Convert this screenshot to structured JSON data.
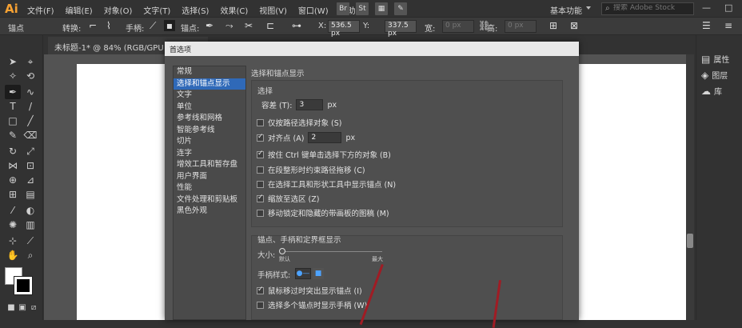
{
  "menubar": {
    "logo": "Ai",
    "items": [
      "文件(F)",
      "编辑(E)",
      "对象(O)",
      "文字(T)",
      "选择(S)",
      "效果(C)",
      "视图(V)",
      "窗口(W)",
      "帮助(H)"
    ],
    "icons": [
      {
        "name": "bridge-icon",
        "glyph": "Br"
      },
      {
        "name": "stock-icon",
        "glyph": "St"
      },
      {
        "name": "arrange-icon",
        "glyph": "▦"
      },
      {
        "name": "gpu-icon",
        "glyph": "✎"
      }
    ],
    "workspace": "基本功能",
    "search_placeholder": "搜索 Adobe Stock",
    "window_min": "—",
    "window_max": "□"
  },
  "control_bar": {
    "anchor_label": "锚点",
    "convert_label": "转换:",
    "handle_label": "手柄:",
    "anchor2_label": "锚点:",
    "x_label": "X:",
    "x_value": "536.5 px",
    "y_label": "Y:",
    "y_value": "337.5 px",
    "w_label": "宽:",
    "w_value": "0 px",
    "h_label": "高:",
    "h_value": "0 px"
  },
  "document_tab": "未标题-1* @ 84% (RGB/GPU 预览)",
  "right_panel": {
    "items": [
      {
        "label": "属性",
        "icon": "properties-icon"
      },
      {
        "label": "图层",
        "icon": "layers-icon"
      },
      {
        "label": "库",
        "icon": "libraries-icon"
      }
    ]
  },
  "dialog": {
    "title": "首选项",
    "nav": [
      "常规",
      "选择和锚点显示",
      "文字",
      "单位",
      "参考线和网格",
      "智能参考线",
      "切片",
      "连字",
      "增效工具和暂存盘",
      "用户界面",
      "性能",
      "文件处理和剪贴板",
      "黑色外观"
    ],
    "selected_nav": 1,
    "heading": "选择和锚点显示",
    "selection": {
      "title": "选择",
      "tolerance_label": "容差 (T):",
      "tolerance_value": "3",
      "tolerance_unit": "px",
      "options": [
        {
          "label": "仅按路径选择对象 (S)",
          "checked": false
        },
        {
          "label": "对齐点 (A)",
          "checked": true,
          "value": "2",
          "unit": "px"
        },
        {
          "label": "按住 Ctrl 键单击选择下方的对象 (B)",
          "checked": true
        },
        {
          "label": "在段整形时约束路径拖移 (C)",
          "checked": false
        },
        {
          "label": "在选择工具和形状工具中显示锚点 (N)",
          "checked": false
        },
        {
          "label": "缩放至选区 (Z)",
          "checked": true
        },
        {
          "label": "移动锁定和隐藏的带画板的图稿 (M)",
          "checked": false
        }
      ]
    },
    "anchors": {
      "title": "锚点、手柄和定界框显示",
      "size_label": "大小:",
      "size_min": "默认",
      "size_max": "最大",
      "size_value": 0,
      "handle_style_label": "手柄样式:",
      "options": [
        {
          "label": "鼠标移过时突出显示锚点 (I)",
          "checked": true
        },
        {
          "label": "选择多个锚点时显示手柄 (W)",
          "checked": false
        }
      ]
    }
  }
}
